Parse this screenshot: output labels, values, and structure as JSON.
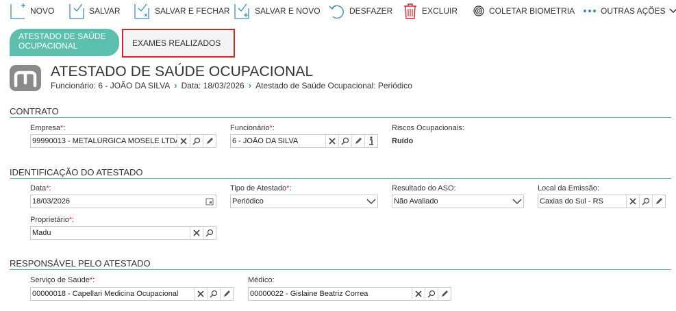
{
  "toolbar": {
    "novo": "NOVO",
    "salvar": "SALVAR",
    "salvar_fechar": "SALVAR E FECHAR",
    "salvar_novo": "SALVAR E NOVO",
    "desfazer": "DESFAZER",
    "excluir": "EXCLUIR",
    "coletar_biometria": "COLETAR BIOMETRIA",
    "outras_acoes": "OUTRAS AÇÕES"
  },
  "tabs": {
    "active": "ATESTADO DE SAÚDE OCUPACIONAL",
    "inactive": "EXAMES REALIZADOS"
  },
  "header": {
    "title": "ATESTADO DE SAÚDE OCUPACIONAL",
    "breadcrumb": [
      "Funcionário: 6 - JOÃO DA SILVA",
      "Data: 18/03/2026",
      "Atestado de Saúde Ocupacional: Periódico"
    ]
  },
  "sections": {
    "contrato": "CONTRATO",
    "identificacao": "IDENTIFICAÇÃO DO ATESTADO",
    "responsavel": "RESPONSÁVEL PELO ATESTADO"
  },
  "contrato": {
    "empresa_label": "Empresa",
    "empresa_value": "99990013 - METALÚRGICA MOSELE LTDA",
    "funcionario_label": "Funcionário",
    "funcionario_value": "6 - JOÃO DA SILVA",
    "riscos_label": "Riscos Ocupacionais:",
    "riscos_value": "Ruído"
  },
  "identificacao": {
    "data_label": "Data",
    "data_value": "18/03/2026",
    "tipo_label": "Tipo de Atestado",
    "tipo_value": "Periódico",
    "resultado_label": "Resultado do ASO:",
    "resultado_value": "Não Avaliado",
    "local_label": "Local da Emissão:",
    "local_value": "Caxias do Sul - RS",
    "proprietario_label": "Proprietário",
    "proprietario_value": "Madu"
  },
  "responsavel": {
    "servico_label": "Serviço de Saúde",
    "servico_value": "00000018 - Capellari Medicina Ocupacional",
    "medico_label": "Médico:",
    "medico_value": "00000022 - Gislaine Beatriz Correa"
  },
  "required_mark": "*",
  "colon": ":",
  "colors": {
    "accent": "#5dbfae",
    "required": "#d0252b",
    "highlight_border": "#d0252b",
    "link": "#3a8ebd"
  },
  "icons": [
    "new-doc-icon",
    "save-icon",
    "save-close-icon",
    "save-new-icon",
    "undo-icon",
    "trash-icon",
    "fingerprint-icon",
    "more-icon",
    "chevron-down-icon",
    "clear-icon",
    "search-icon",
    "edit-icon",
    "info-icon",
    "calendar-icon"
  ]
}
